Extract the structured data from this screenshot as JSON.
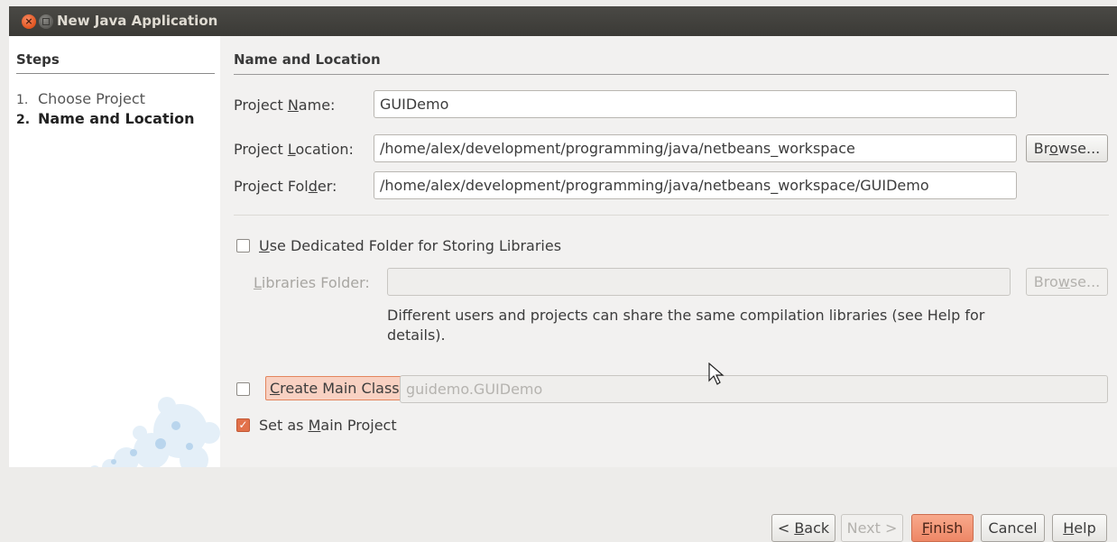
{
  "window": {
    "title": "New Java Application"
  },
  "steps": {
    "title": "Steps",
    "items": [
      {
        "num": "1.",
        "label": "Choose Project"
      },
      {
        "num": "2.",
        "label": "Name and Location"
      }
    ]
  },
  "section": {
    "title": "Name and Location"
  },
  "project_name": {
    "label_pre": "Project ",
    "label_mn": "N",
    "label_post": "ame:",
    "value": "GUIDemo"
  },
  "project_location": {
    "label_pre": "Project ",
    "label_mn": "L",
    "label_post": "ocation:",
    "value": "/home/alex/development/programming/java/netbeans_workspace"
  },
  "browse_button": {
    "pre": "Br",
    "mn": "o",
    "post": "wse..."
  },
  "project_folder": {
    "label_pre": "Project Fol",
    "label_mn": "d",
    "label_post": "er:",
    "value": "/home/alex/development/programming/java/netbeans_workspace/GUIDemo"
  },
  "dedicated_folder": {
    "mn": "U",
    "post": "se Dedicated Folder for Storing Libraries",
    "checked": false
  },
  "libraries_folder": {
    "label_pre": "",
    "label_mn": "L",
    "label_post": "ibraries Folder:",
    "value": ""
  },
  "browse_libs_button": {
    "pre": "Bro",
    "mn": "w",
    "post": "se..."
  },
  "libraries_help": {
    "line1": "Different users and projects can share the same compilation libraries (see Help for",
    "line2": "details)."
  },
  "create_main_class": {
    "mn": "C",
    "post": "reate Main Class",
    "checked": false,
    "value": "guidemo.GUIDemo"
  },
  "set_main_project": {
    "pre": "Set as ",
    "mn": "M",
    "post": "ain Project",
    "checked": true
  },
  "buttons": {
    "back": {
      "pre": "< ",
      "mn": "B",
      "post": "ack"
    },
    "next": {
      "label": "Next >"
    },
    "finish": {
      "mn": "F",
      "post": "inish"
    },
    "cancel": {
      "label": "Cancel"
    },
    "help": {
      "mn": "H",
      "post": "elp"
    }
  },
  "colors": {
    "accent": "#ee8766",
    "titlebar": "#3b3a36",
    "check_on": "#e2714a"
  }
}
